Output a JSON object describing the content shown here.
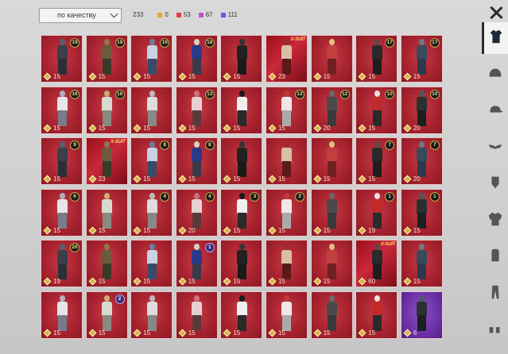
{
  "toolbar": {
    "sort_label": "по качеству",
    "total": "233",
    "stats": [
      {
        "value": "0",
        "color": "#f0a52c"
      },
      {
        "value": "53",
        "color": "#e04040"
      },
      {
        "value": "67",
        "color": "#c24fd0"
      },
      {
        "value": "111",
        "color": "#7b4de0"
      }
    ]
  },
  "items": [
    {
      "count": "15",
      "badge": "19",
      "tone": "red"
    },
    {
      "count": "15",
      "badge": "19",
      "tone": "red"
    },
    {
      "count": "15",
      "badge": "19",
      "tone": "red"
    },
    {
      "count": "15",
      "badge": "18",
      "tone": "red"
    },
    {
      "count": "15",
      "badge": "",
      "tone": "red"
    },
    {
      "count": "23",
      "badge": "",
      "tag": "X-SUIT",
      "tone": "xsuit"
    },
    {
      "count": "15",
      "badge": "",
      "tone": "red"
    },
    {
      "count": "15",
      "badge": "17",
      "tone": "red"
    },
    {
      "count": "15",
      "badge": "17",
      "tone": "red"
    },
    {
      "count": "15",
      "badge": "16",
      "tone": "red"
    },
    {
      "count": "15",
      "badge": "16",
      "tone": "red"
    },
    {
      "count": "15",
      "badge": "",
      "tone": "red"
    },
    {
      "count": "15",
      "badge": "13",
      "tone": "red"
    },
    {
      "count": "15",
      "badge": "",
      "tone": "red"
    },
    {
      "count": "15",
      "badge": "12",
      "tone": "red"
    },
    {
      "count": "20",
      "badge": "12",
      "tone": "red"
    },
    {
      "count": "15",
      "badge": "10",
      "tone": "red"
    },
    {
      "count": "20",
      "badge": "10",
      "tone": "red"
    },
    {
      "count": "15",
      "badge": "9",
      "tone": "red"
    },
    {
      "count": "23",
      "badge": "",
      "tag": "X-SUIT",
      "tone": "xsuit"
    },
    {
      "count": "15",
      "badge": "8",
      "tone": "red"
    },
    {
      "count": "15",
      "badge": "8",
      "tone": "red"
    },
    {
      "count": "15",
      "badge": "",
      "tone": "red"
    },
    {
      "count": "15",
      "badge": "",
      "tone": "red"
    },
    {
      "count": "15",
      "badge": "",
      "tone": "red"
    },
    {
      "count": "15",
      "badge": "7",
      "tone": "red"
    },
    {
      "count": "20",
      "badge": "7",
      "tone": "red"
    },
    {
      "count": "15",
      "badge": "6",
      "tone": "red"
    },
    {
      "count": "15",
      "badge": "",
      "tone": "red"
    },
    {
      "count": "15",
      "badge": "4",
      "tone": "red"
    },
    {
      "count": "20",
      "badge": "4",
      "tone": "red"
    },
    {
      "count": "15",
      "badge": "3",
      "tone": "red"
    },
    {
      "count": "15",
      "badge": "3",
      "tone": "red"
    },
    {
      "count": "15",
      "badge": "",
      "tone": "red"
    },
    {
      "count": "19",
      "badge": "1",
      "tone": "red"
    },
    {
      "count": "15",
      "badge": "1",
      "tone": "red"
    },
    {
      "count": "19",
      "badge": "20",
      "tone": "red"
    },
    {
      "count": "15",
      "badge": "",
      "tone": "red"
    },
    {
      "count": "15",
      "badge": "",
      "tone": "red"
    },
    {
      "count": "15",
      "badge": "1",
      "badge_style": "violet",
      "tone": "red"
    },
    {
      "count": "15",
      "badge": "",
      "tone": "red"
    },
    {
      "count": "15",
      "badge": "",
      "tone": "red"
    },
    {
      "count": "15",
      "badge": "",
      "tone": "red"
    },
    {
      "count": "60",
      "badge": "",
      "tag": "X-SUIT",
      "tone": "xsuit"
    },
    {
      "count": "15",
      "badge": "",
      "tone": "red"
    },
    {
      "count": "15",
      "badge": "",
      "tone": "red"
    },
    {
      "count": "15",
      "badge": "2",
      "badge_style": "violet",
      "tone": "red"
    },
    {
      "count": "15",
      "badge": "",
      "tone": "red"
    },
    {
      "count": "15",
      "badge": "",
      "tone": "red"
    },
    {
      "count": "15",
      "badge": "",
      "tone": "red"
    },
    {
      "count": "15",
      "badge": "",
      "tone": "red"
    },
    {
      "count": "15",
      "badge": "",
      "tone": "red"
    },
    {
      "count": "15",
      "badge": "",
      "tone": "red"
    },
    {
      "count": "6",
      "badge": "",
      "tone": "purple"
    }
  ],
  "sidebar": [
    {
      "icon": "outfit-icon",
      "active": true
    },
    {
      "icon": "helmet-icon",
      "active": false
    },
    {
      "icon": "cap-icon",
      "active": false
    },
    {
      "icon": "mask-icon",
      "active": false
    },
    {
      "icon": "face-icon",
      "active": false
    },
    {
      "icon": "jacket-icon",
      "active": false
    },
    {
      "icon": "backpack-icon",
      "active": false
    },
    {
      "icon": "pants-icon",
      "active": false
    },
    {
      "icon": "shoes-icon",
      "active": false
    }
  ]
}
